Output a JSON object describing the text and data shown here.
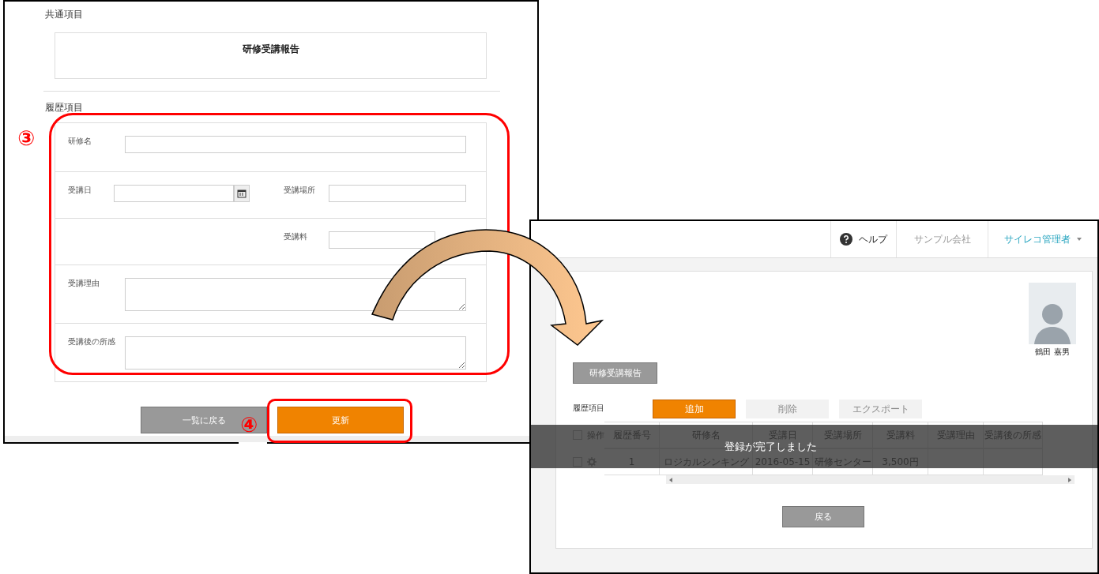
{
  "left_window": {
    "common_section": {
      "label": "共通項目",
      "title": "研修受講報告"
    },
    "history_section": {
      "label": "履歴項目",
      "rows": [
        {
          "fields": [
            {
              "kind": "wide",
              "label": "研修名"
            }
          ]
        },
        {
          "fields": [
            {
              "kind": "date",
              "label": "受講日"
            },
            {
              "kind": "half",
              "label": "受講場所"
            }
          ]
        },
        {
          "fields": [
            {
              "kind": "half",
              "label": "受講料"
            }
          ]
        },
        {
          "fields": [
            {
              "kind": "textarea",
              "label": "受講理由"
            }
          ]
        },
        {
          "fields": [
            {
              "kind": "textarea",
              "label": "受講後の所感"
            }
          ]
        }
      ]
    },
    "buttons": [
      {
        "kind": "secondary",
        "label": "一覧に戻る"
      },
      {
        "kind": "primary",
        "label": "更新"
      }
    ]
  },
  "annotations": [
    {
      "label": "③"
    },
    {
      "label": "④"
    }
  ],
  "right_window": {
    "header": {
      "help": "ヘルプ",
      "company": "サンプル会社",
      "user": "サイレコ管理者"
    },
    "employee": {
      "name": "鶴田 嘉男"
    },
    "report_button": "研修受講報告",
    "history": {
      "label": "履歴項目",
      "actions": [
        {
          "label": "追加",
          "disabled": false
        },
        {
          "label": "削除",
          "disabled": true
        },
        {
          "label": "エクスポート",
          "disabled": true
        }
      ],
      "select_all_checked": false,
      "operation_header": "操作",
      "columns": [
        "履歴番号",
        "研修名",
        "受講日",
        "受講場所",
        "受講料",
        "受講理由",
        "受講後の所感"
      ],
      "rows": [
        {
          "checked": false,
          "cells": [
            "1",
            "ロジカルシンキング",
            "2016-05-15",
            "研修センター",
            "3,500円"
          ]
        }
      ]
    },
    "back_button": "戻る",
    "toast": "登録が完了しました"
  }
}
